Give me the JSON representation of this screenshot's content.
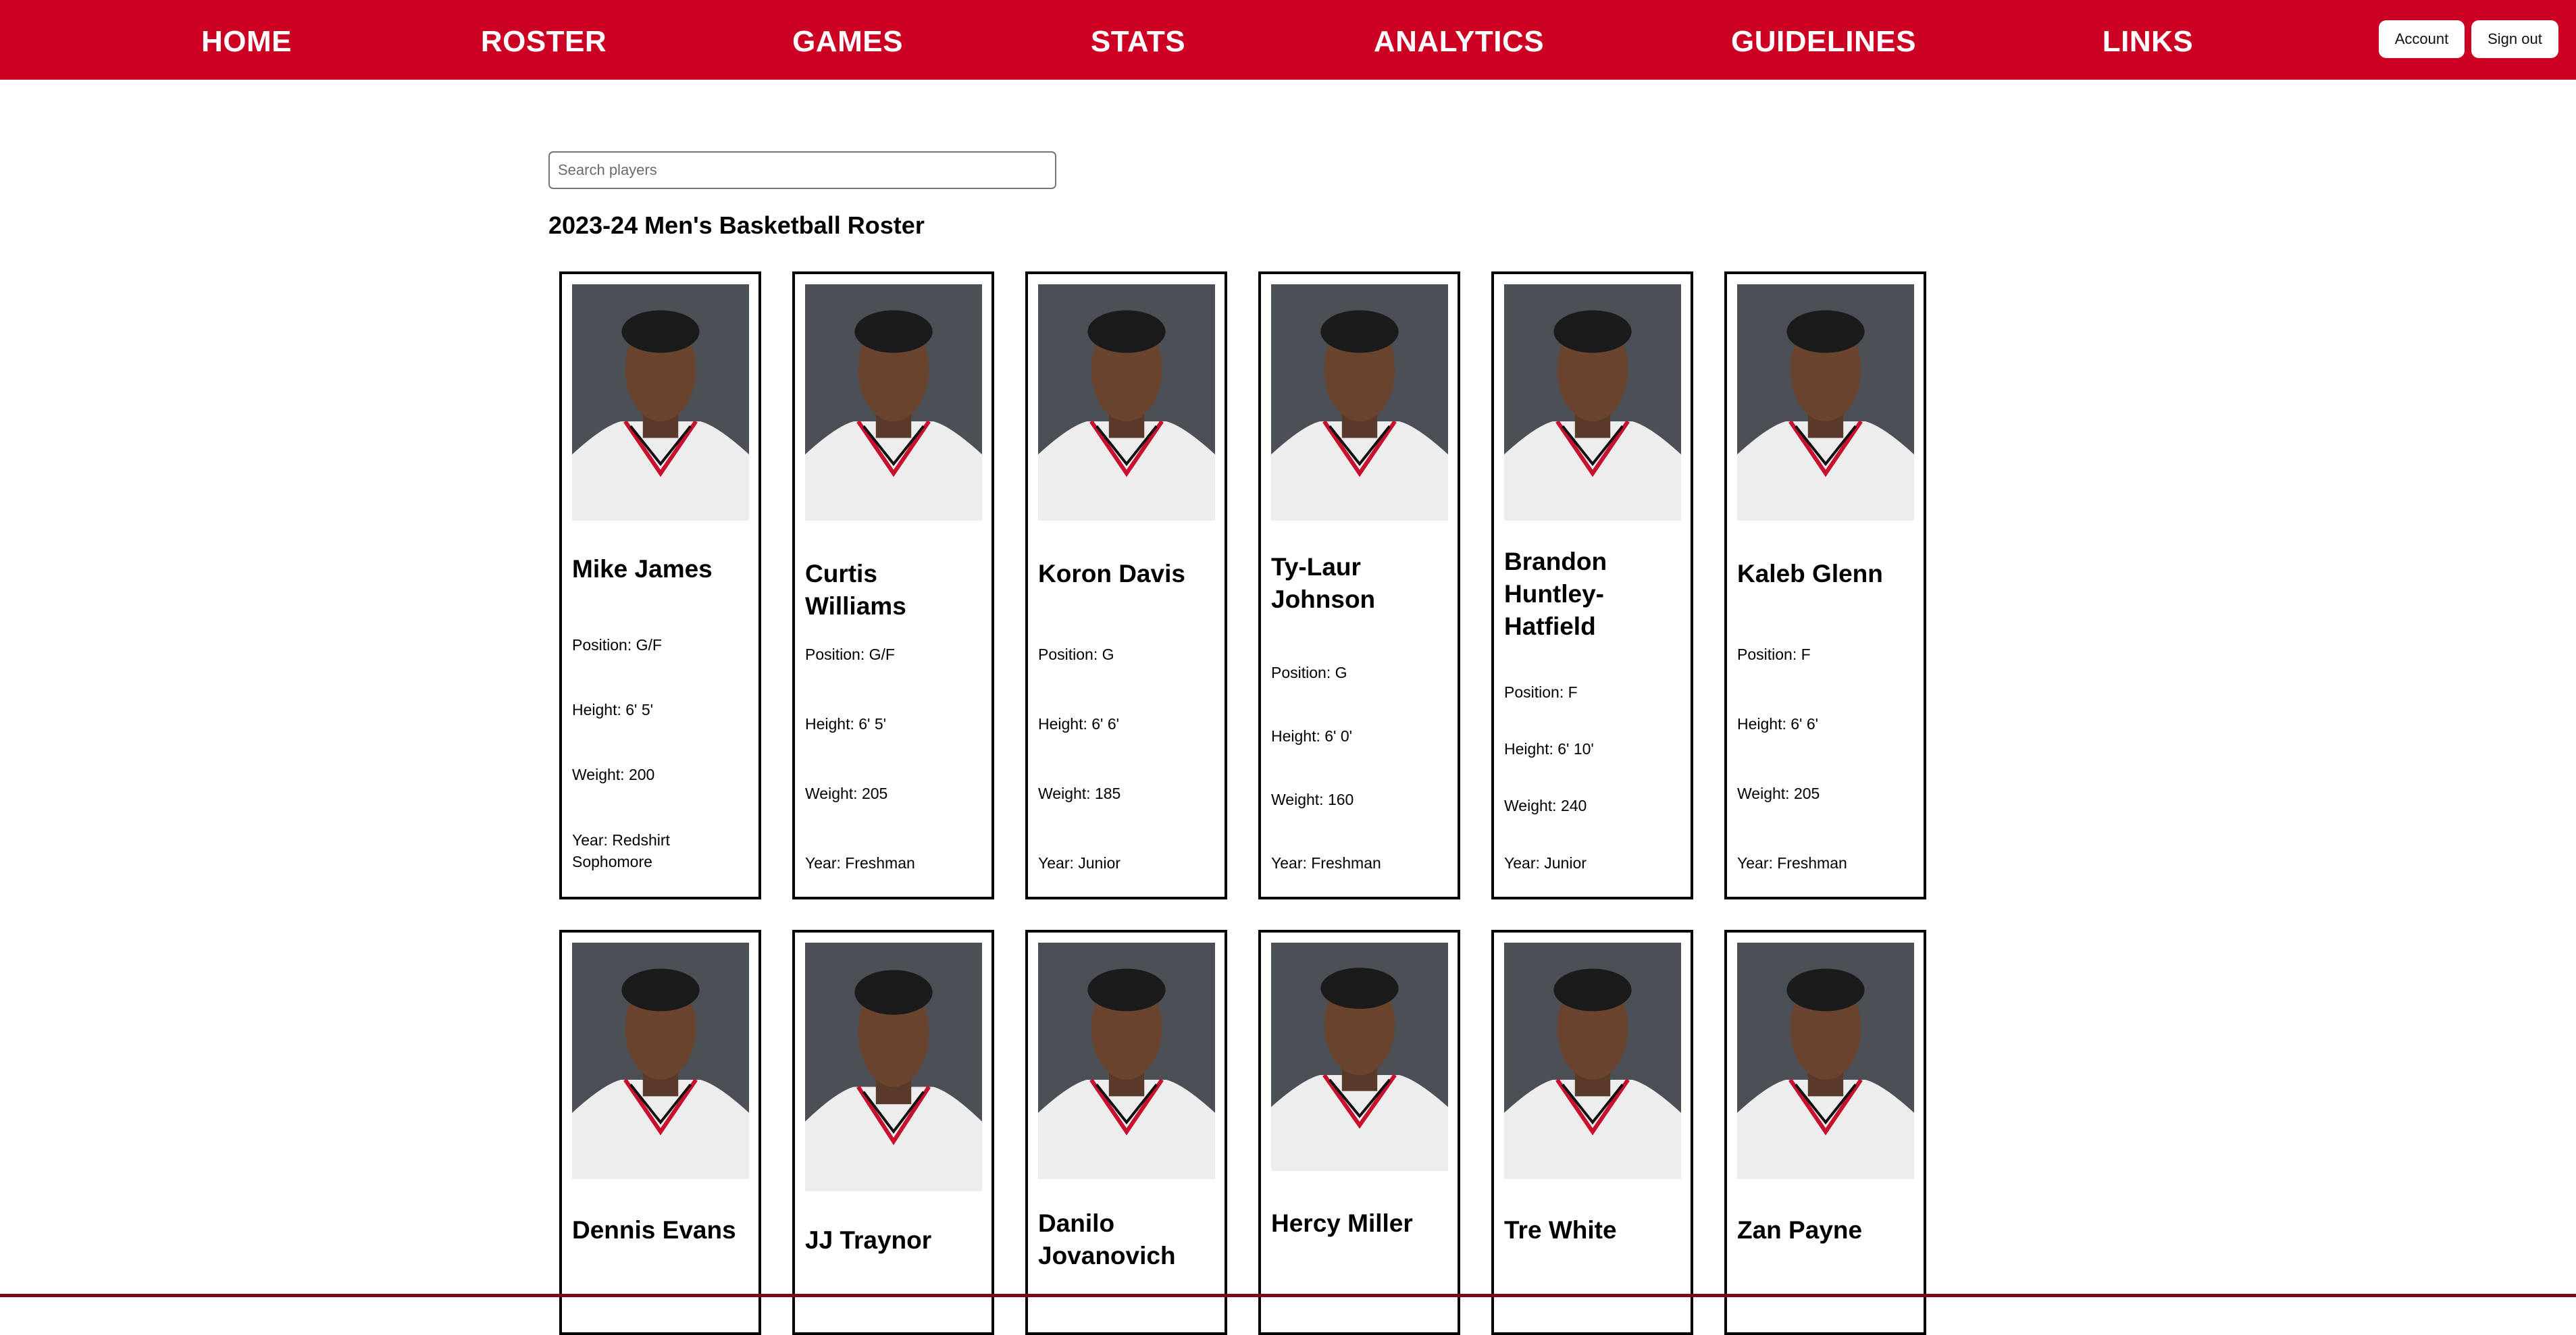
{
  "nav": {
    "items": [
      "HOME",
      "ROSTER",
      "GAMES",
      "STATS",
      "ANALYTICS",
      "GUIDELINES",
      "LINKS"
    ],
    "account_label": "Account",
    "signout_label": "Sign out"
  },
  "colors": {
    "brand": "#cc0022",
    "photo_bg": "#4b5057"
  },
  "search": {
    "placeholder": "Search players",
    "value": ""
  },
  "roster": {
    "title": "2023-24 Men's Basketball Roster",
    "players": [
      {
        "name": "Mike James",
        "position": "Position: G/F",
        "height": "Height: 6' 5'",
        "weight": "Weight: 200",
        "year": "Year: Redshirt Sophomore"
      },
      {
        "name": "Curtis Williams",
        "position": "Position: G/F",
        "height": "Height: 6' 5'",
        "weight": "Weight: 205",
        "year": "Year: Freshman"
      },
      {
        "name": "Koron Davis",
        "position": "Position: G",
        "height": "Height: 6' 6'",
        "weight": "Weight: 185",
        "year": "Year: Junior"
      },
      {
        "name": "Ty-Laur Johnson",
        "position": "Position: G",
        "height": "Height: 6' 0'",
        "weight": "Weight: 160",
        "year": "Year: Freshman"
      },
      {
        "name": "Brandon Huntley-Hatfield",
        "position": "Position: F",
        "height": "Height: 6' 10'",
        "weight": "Weight: 240",
        "year": "Year: Junior"
      },
      {
        "name": "Kaleb Glenn",
        "position": "Position: F",
        "height": "Height: 6' 6'",
        "weight": "Weight: 205",
        "year": "Year: Freshman"
      },
      {
        "name": "Dennis Evans"
      },
      {
        "name": "JJ Traynor"
      },
      {
        "name": "Danilo Jovanovich"
      },
      {
        "name": "Hercy Miller"
      },
      {
        "name": "Tre White"
      },
      {
        "name": "Zan Payne"
      }
    ]
  }
}
